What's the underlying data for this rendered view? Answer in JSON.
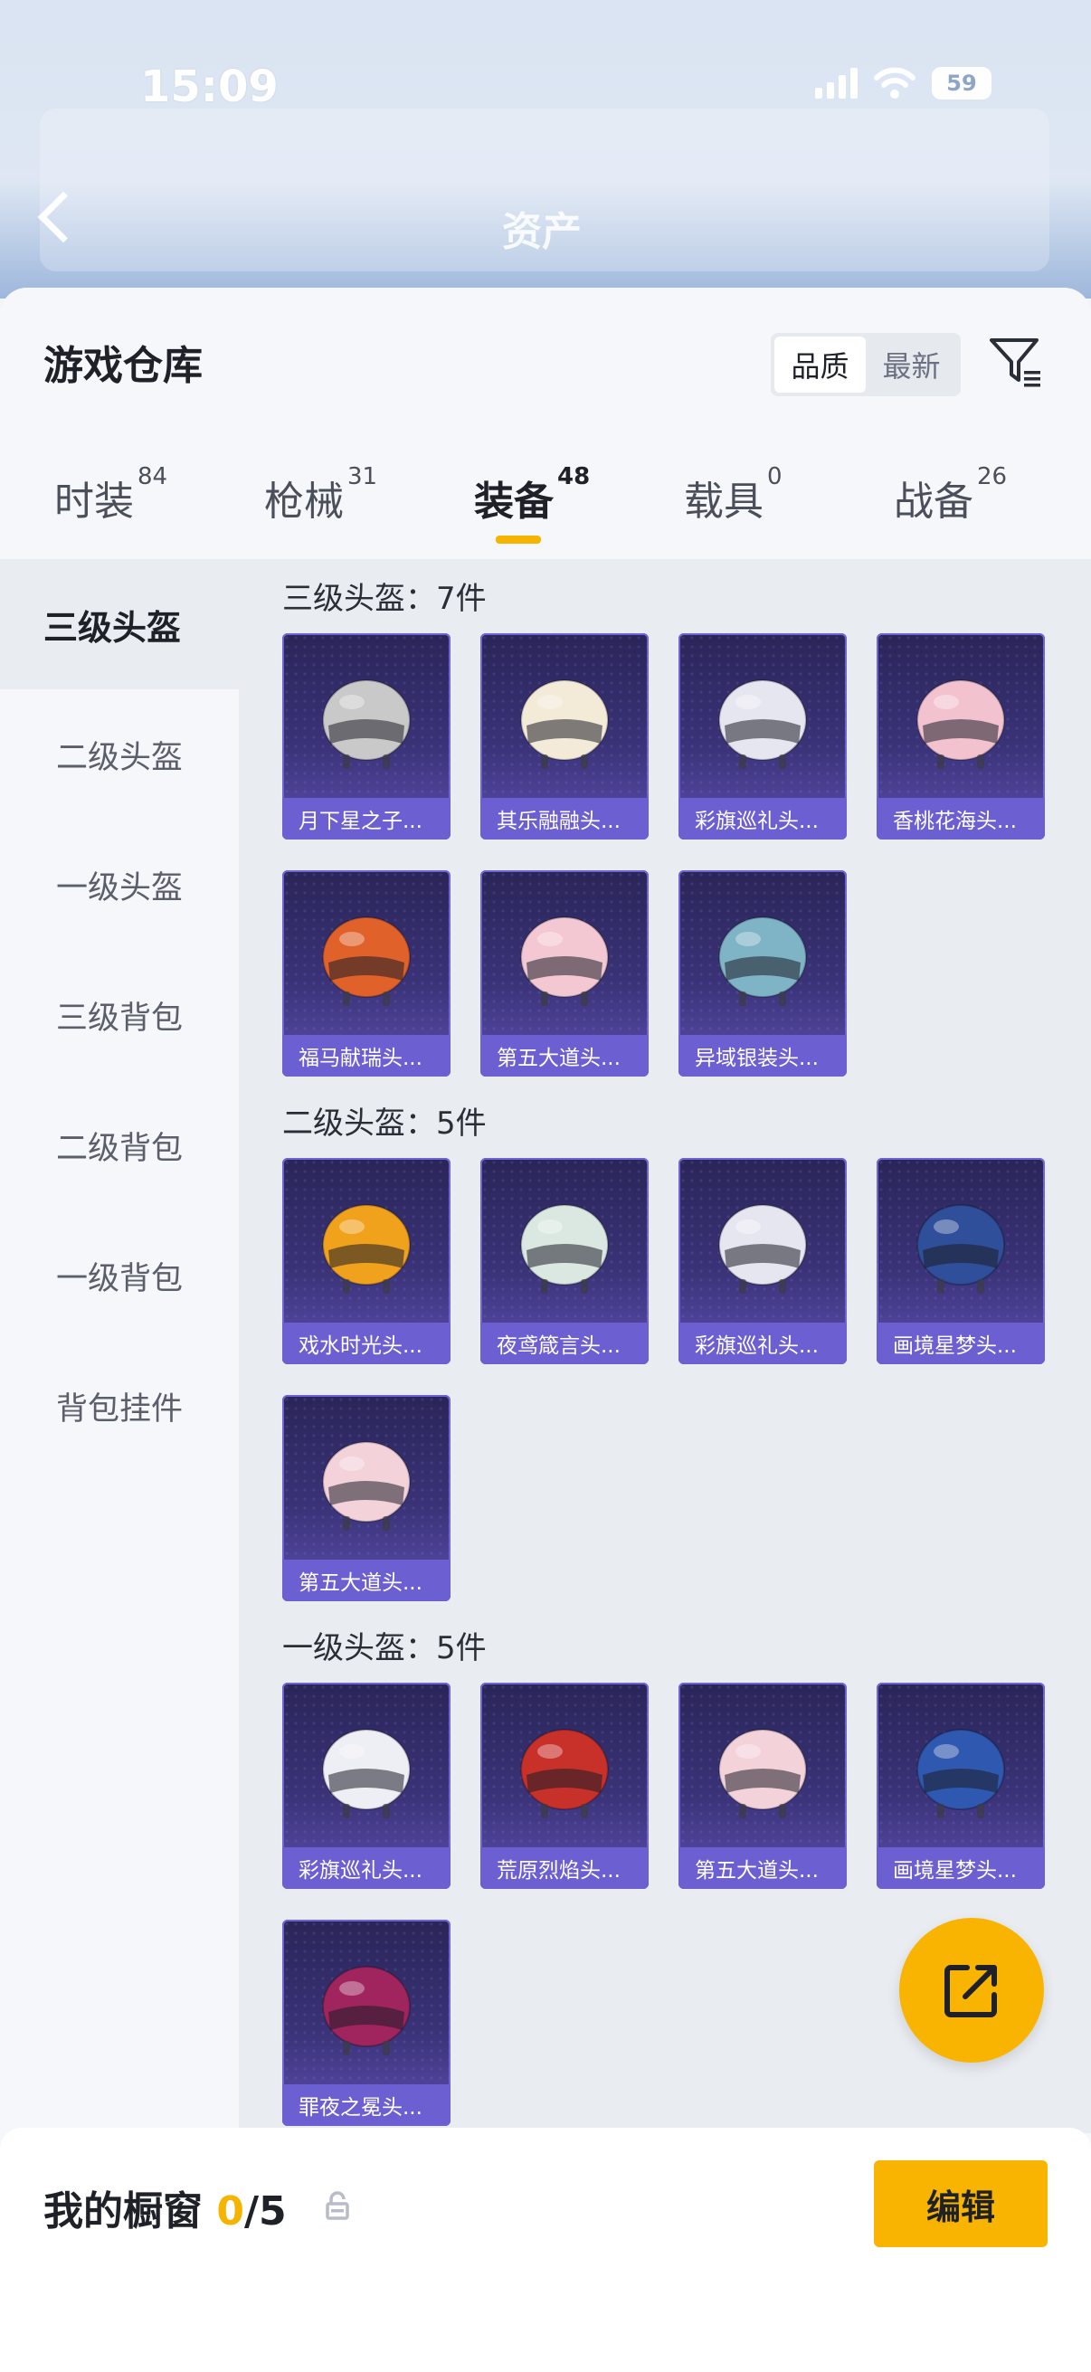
{
  "status_bar": {
    "time": "15:09",
    "battery": "59"
  },
  "background": {
    "assets_label": "资产"
  },
  "warehouse": {
    "title": "游戏仓库",
    "sort_options": [
      "品质",
      "最新"
    ],
    "sort_selected": "品质"
  },
  "tabs": [
    {
      "label": "时装",
      "count": "84"
    },
    {
      "label": "枪械",
      "count": "31"
    },
    {
      "label": "装备",
      "count": "48"
    },
    {
      "label": "载具",
      "count": "0"
    },
    {
      "label": "战备",
      "count": "26"
    }
  ],
  "active_tab": "装备",
  "categories": [
    "三级头盔",
    "二级头盔",
    "一级头盔",
    "三级背包",
    "二级背包",
    "一级背包",
    "背包挂件"
  ],
  "active_category": "三级头盔",
  "sections": [
    {
      "title": "三级头盔：7件",
      "items": [
        {
          "name": "月下星之子...",
          "icon": "knight-helmet-icon",
          "color": "#c9c9c9"
        },
        {
          "name": "其乐融融头...",
          "icon": "white-helmet-icon",
          "color": "#f3ead8"
        },
        {
          "name": "彩旗巡礼头...",
          "icon": "cow-helmet-icon",
          "color": "#e6e6f0"
        },
        {
          "name": "香桃花海头...",
          "icon": "pink-helmet-icon",
          "color": "#f2c3cf"
        },
        {
          "name": "福马献瑞头...",
          "icon": "horse-helmet-icon",
          "color": "#e0612a"
        },
        {
          "name": "第五大道头...",
          "icon": "plaid-helmet-icon",
          "color": "#f3c8d2"
        },
        {
          "name": "异域银装头...",
          "icon": "silver-helmet-icon",
          "color": "#7fb3c6"
        }
      ]
    },
    {
      "title": "二级头盔：5件",
      "items": [
        {
          "name": "戏水时光头...",
          "icon": "giraffe-helmet-icon",
          "color": "#f0a21c"
        },
        {
          "name": "夜鸢箴言头...",
          "icon": "bird-helmet-icon",
          "color": "#dbe8e2"
        },
        {
          "name": "彩旗巡礼头...",
          "icon": "cow-helmet-icon",
          "color": "#e6e6f0"
        },
        {
          "name": "画境星梦头...",
          "icon": "starry-helmet-icon",
          "color": "#2f4f9a"
        },
        {
          "name": "第五大道头...",
          "icon": "plaid-helmet-icon",
          "color": "#f3d2da"
        }
      ]
    },
    {
      "title": "一级头盔：5件",
      "items": [
        {
          "name": "彩旗巡礼头...",
          "icon": "cow-helmet-icon",
          "color": "#eeeef5"
        },
        {
          "name": "荒原烈焰头...",
          "icon": "red-helmet-icon",
          "color": "#c8302a"
        },
        {
          "name": "第五大道头...",
          "icon": "plaid-helmet-icon",
          "color": "#f3d2da"
        },
        {
          "name": "画境星梦头...",
          "icon": "starry-helmet-icon",
          "color": "#2f58b0"
        },
        {
          "name": "罪夜之冕头...",
          "icon": "dark-helmet-icon",
          "color": "#a0245e"
        }
      ]
    }
  ],
  "showcase": {
    "label": "我的橱窗",
    "current": "0",
    "total": "/5"
  },
  "edit_button": "编辑",
  "colors": {
    "accent": "#f8b400",
    "card_top": "#2a2558",
    "card_label": "#6c5fd2"
  }
}
